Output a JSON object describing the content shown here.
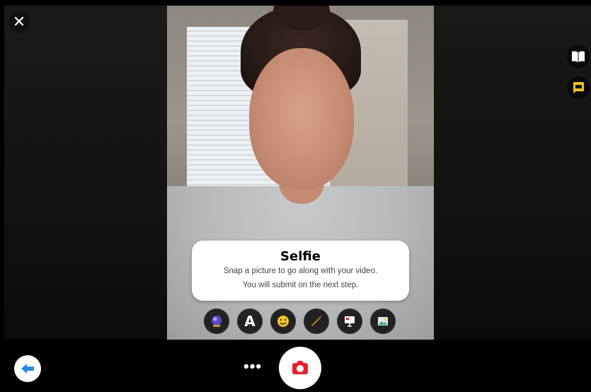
{
  "card": {
    "title": "Selfie",
    "line1": "Snap a picture to go along with your video.",
    "line2": "You will submit on the next step."
  },
  "toolbar": {
    "text_tool_label": "A",
    "more_label": "•••"
  },
  "buttons": {
    "close_label": "✕"
  },
  "icons": {
    "close": "close-icon",
    "side_top": "book-icon",
    "side_bottom": "sticky-note-icon",
    "tools": [
      "crystal-ball-icon",
      "text-icon",
      "emoji-icon",
      "pen-icon",
      "board-icon",
      "image-icon"
    ],
    "back": "arrow-left-icon",
    "capture": "camera-icon"
  },
  "colors": {
    "accent_red": "#e8202a",
    "accent_blue": "#2a8ae8",
    "tool_yellow": "#f0c020",
    "card_bg": "#ffffff"
  }
}
